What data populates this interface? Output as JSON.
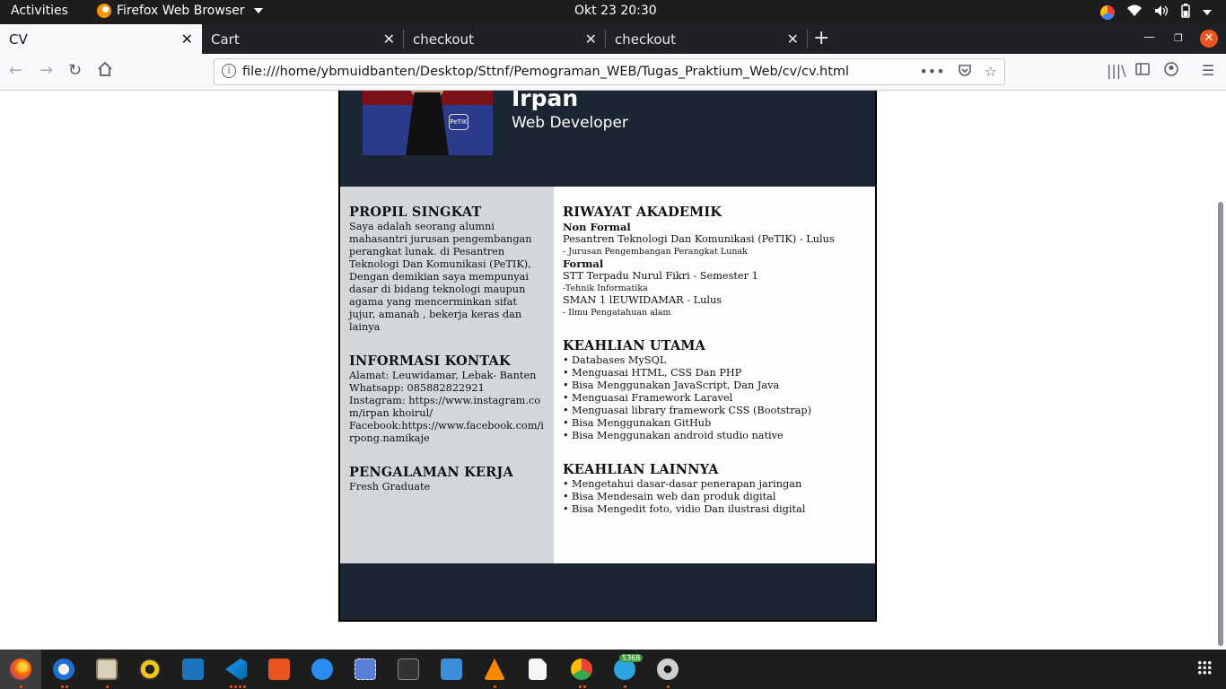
{
  "topbar": {
    "activities": "Activities",
    "app_name": "Firefox Web Browser",
    "clock": "Okt 23  20:30"
  },
  "tabs": [
    {
      "label": "CV",
      "active": true
    },
    {
      "label": "Cart",
      "active": false
    },
    {
      "label": "checkout",
      "active": false
    },
    {
      "label": "checkout",
      "active": false
    }
  ],
  "navbar": {
    "url": "file:///home/ybmuidbanten/Desktop/Sttnf/Pemograman_WEB/Tugas_Praktium_Web/cv/cv.html"
  },
  "cv": {
    "name": "Irpan",
    "role": "Web Developer",
    "photo_logo": "PeTIK",
    "profile": {
      "title": "PROPIL SINGKAT",
      "text": "Saya adalah seorang alumni mahasantri jurusan pengembangan perangkat lunak. di Pesantren Teknologi Dan Komunikasi (PeTIK), Dengan demikian saya mempunyai dasar di bidang teknologi maupun agama yang mencerminkan sifat jujur, amanah , bekerja keras dan lainya"
    },
    "contact": {
      "title": "INFORMASI KONTAK",
      "lines": [
        "Alamat: Leuwidamar, Lebak- Banten",
        "Whatsapp: 085882822921",
        "Instagram: https://www.instagram.com/irpan khoirul/",
        "Facebook:https://www.facebook.com/irpong.namikaje"
      ]
    },
    "experience": {
      "title": "PENGALAMAN KERJA",
      "text": "Fresh Graduate"
    },
    "education": {
      "title": "RIWAYAT AKADEMIK",
      "nonformal_label": "Non Formal",
      "nonformal_line": "Pesantren Teknologi Dan Komunikasi (PeTIK) - Lulus",
      "nonformal_detail": "- Jurusan Pengembangan Perangkat Lunak",
      "formal_label": "Formal",
      "formal_line1": "STT Terpadu Nurul Fikri - Semester 1",
      "formal_detail1": "-Tehnik Informatika",
      "formal_line2": "SMAN 1 lEUWIDAMAR - Lulus",
      "formal_detail2": "- Ilmu Pengatahuan alam"
    },
    "main_skills": {
      "title": "KEAHLIAN UTAMA",
      "items": [
        "Databases MySQL",
        "Menguasai HTML, CSS Dan PHP",
        "Bisa Menggunakan JavaScript, Dan Java",
        "Menguasai Framework Laravel",
        "Menguasai library framework CSS (Bootstrap)",
        "Bisa Menggunakan GitHub",
        "Bisa Menggunakan android studio native"
      ]
    },
    "other_skills": {
      "title": "KEAHLIAN LAINNYA",
      "items": [
        "Mengetahui dasar-dasar penerapan jaringan",
        "Bisa Mendesain web dan produk digital",
        "Bisa Mengedit foto, vidio Dan ilustrasi digital"
      ]
    }
  },
  "dock": {
    "telegram_badge": "5368",
    "apps": [
      "firefox-icon",
      "thunderbird-icon",
      "files-icon",
      "rhythmbox-icon",
      "writer-icon",
      "vscode-icon",
      "software-center-icon",
      "help-icon",
      "screenshot-icon",
      "terminal-icon",
      "system-monitor-icon",
      "vlc-icon",
      "text-file-icon",
      "chrome-icon",
      "telegram-icon",
      "settings-icon"
    ]
  }
}
